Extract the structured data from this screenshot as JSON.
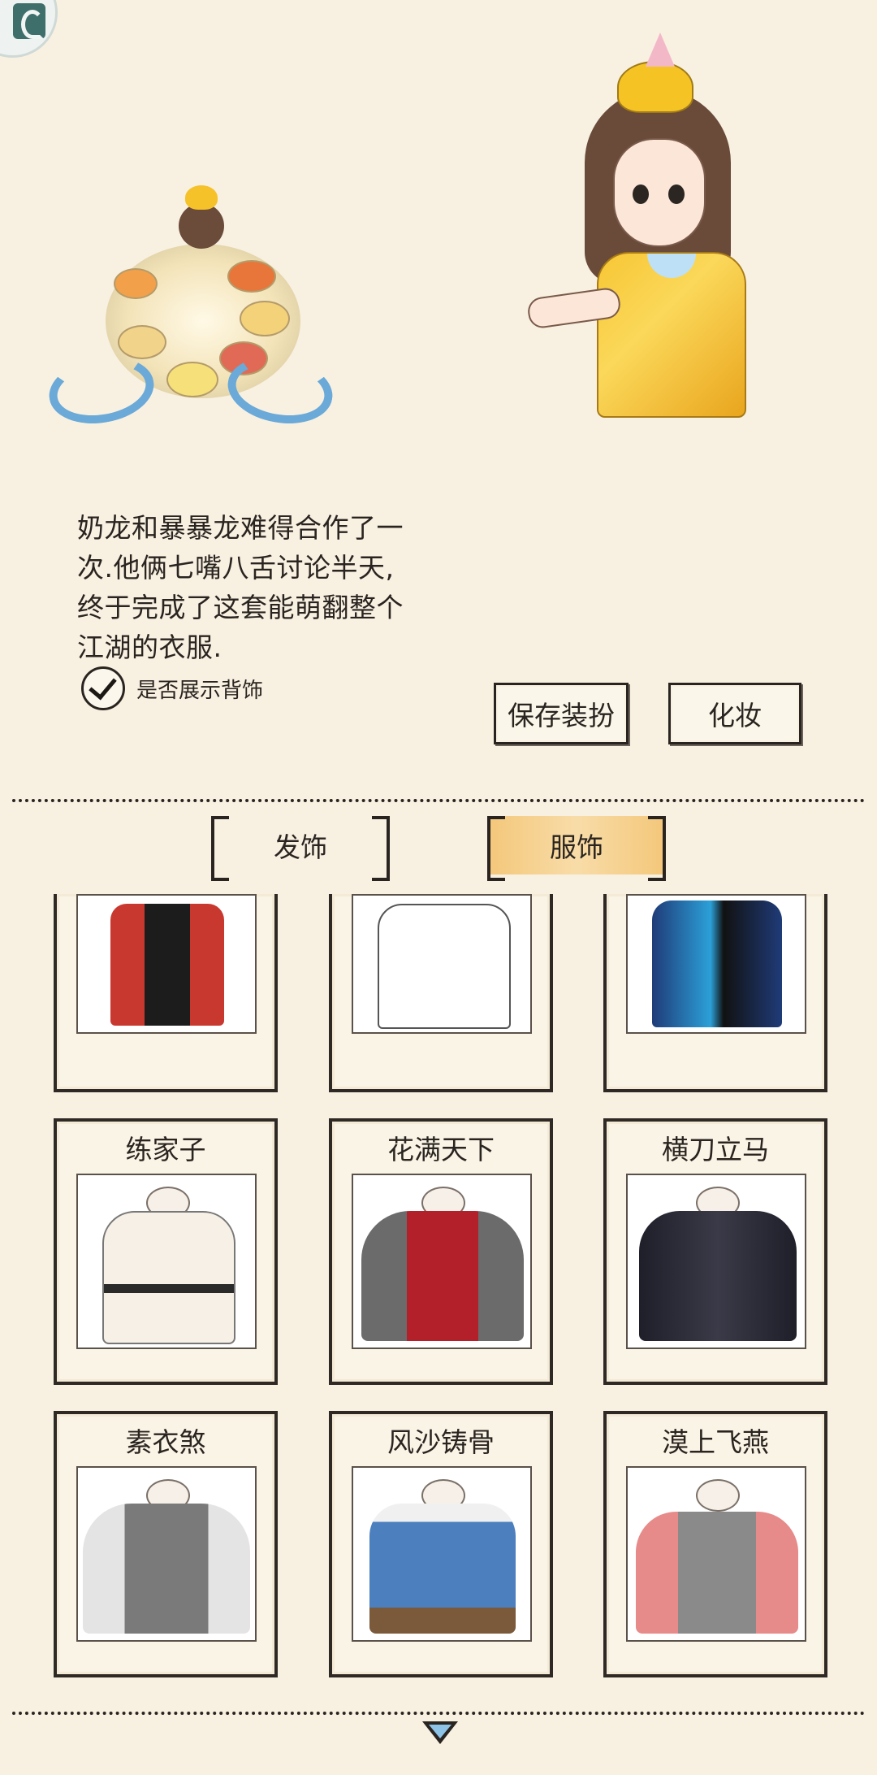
{
  "description": {
    "lines": [
      "奶龙和暴暴龙难得合作了一",
      "次.他俩七嘴八舌讨论半天,",
      "终于完成了这套能萌翻整个",
      "江湖的衣服."
    ]
  },
  "show_back_accessory": {
    "label": "是否展示背饰",
    "checked": true
  },
  "buttons": {
    "save": "保存装扮",
    "makeup": "化妆"
  },
  "tabs": [
    {
      "label": "发饰",
      "active": false
    },
    {
      "label": "服饰",
      "active": true
    }
  ],
  "outfits": [
    {
      "name": "",
      "colors": [
        "#c9382f",
        "#1c1c1c"
      ]
    },
    {
      "name": "",
      "colors": [
        "#ffffff",
        "#ececec"
      ]
    },
    {
      "name": "",
      "colors": [
        "#1f3b78",
        "#2ba0d8"
      ]
    },
    {
      "name": "练家子",
      "colors": [
        "#f6f0e6",
        "#2a2a2a"
      ]
    },
    {
      "name": "花满天下",
      "colors": [
        "#b3202a",
        "#6b6b6b"
      ]
    },
    {
      "name": "横刀立马",
      "colors": [
        "#1f1f2a",
        "#3a3a48"
      ]
    },
    {
      "name": "素衣煞",
      "colors": [
        "#e4e4e4",
        "#7a7a7a"
      ]
    },
    {
      "name": "风沙铸骨",
      "colors": [
        "#4c7fbe",
        "#7a5a3a"
      ]
    },
    {
      "name": "漠上飞燕",
      "colors": [
        "#e68a8a",
        "#8a8a8a"
      ]
    }
  ],
  "accent": "#f6c77a"
}
